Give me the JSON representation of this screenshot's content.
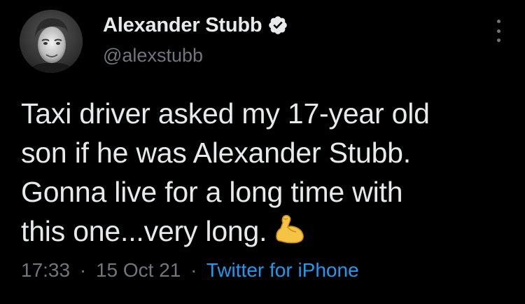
{
  "author": {
    "display_name": "Alexander Stubb",
    "handle": "@alexstubb",
    "verified": true,
    "verified_color": "#e7e9ea"
  },
  "tweet": {
    "lines": [
      "Taxi driver asked my 17-year old",
      "son if he was Alexander Stubb.",
      "Gonna live for a long time with",
      "this one...very long."
    ],
    "emoji": "flexed-biceps-icon"
  },
  "meta": {
    "time": "17:33",
    "date": "15 Oct 21",
    "separator": "·",
    "source": "Twitter for iPhone"
  },
  "colors": {
    "background": "#000000",
    "text": "#e7e9ea",
    "muted": "#71767b",
    "link": "#1d9bf0"
  }
}
